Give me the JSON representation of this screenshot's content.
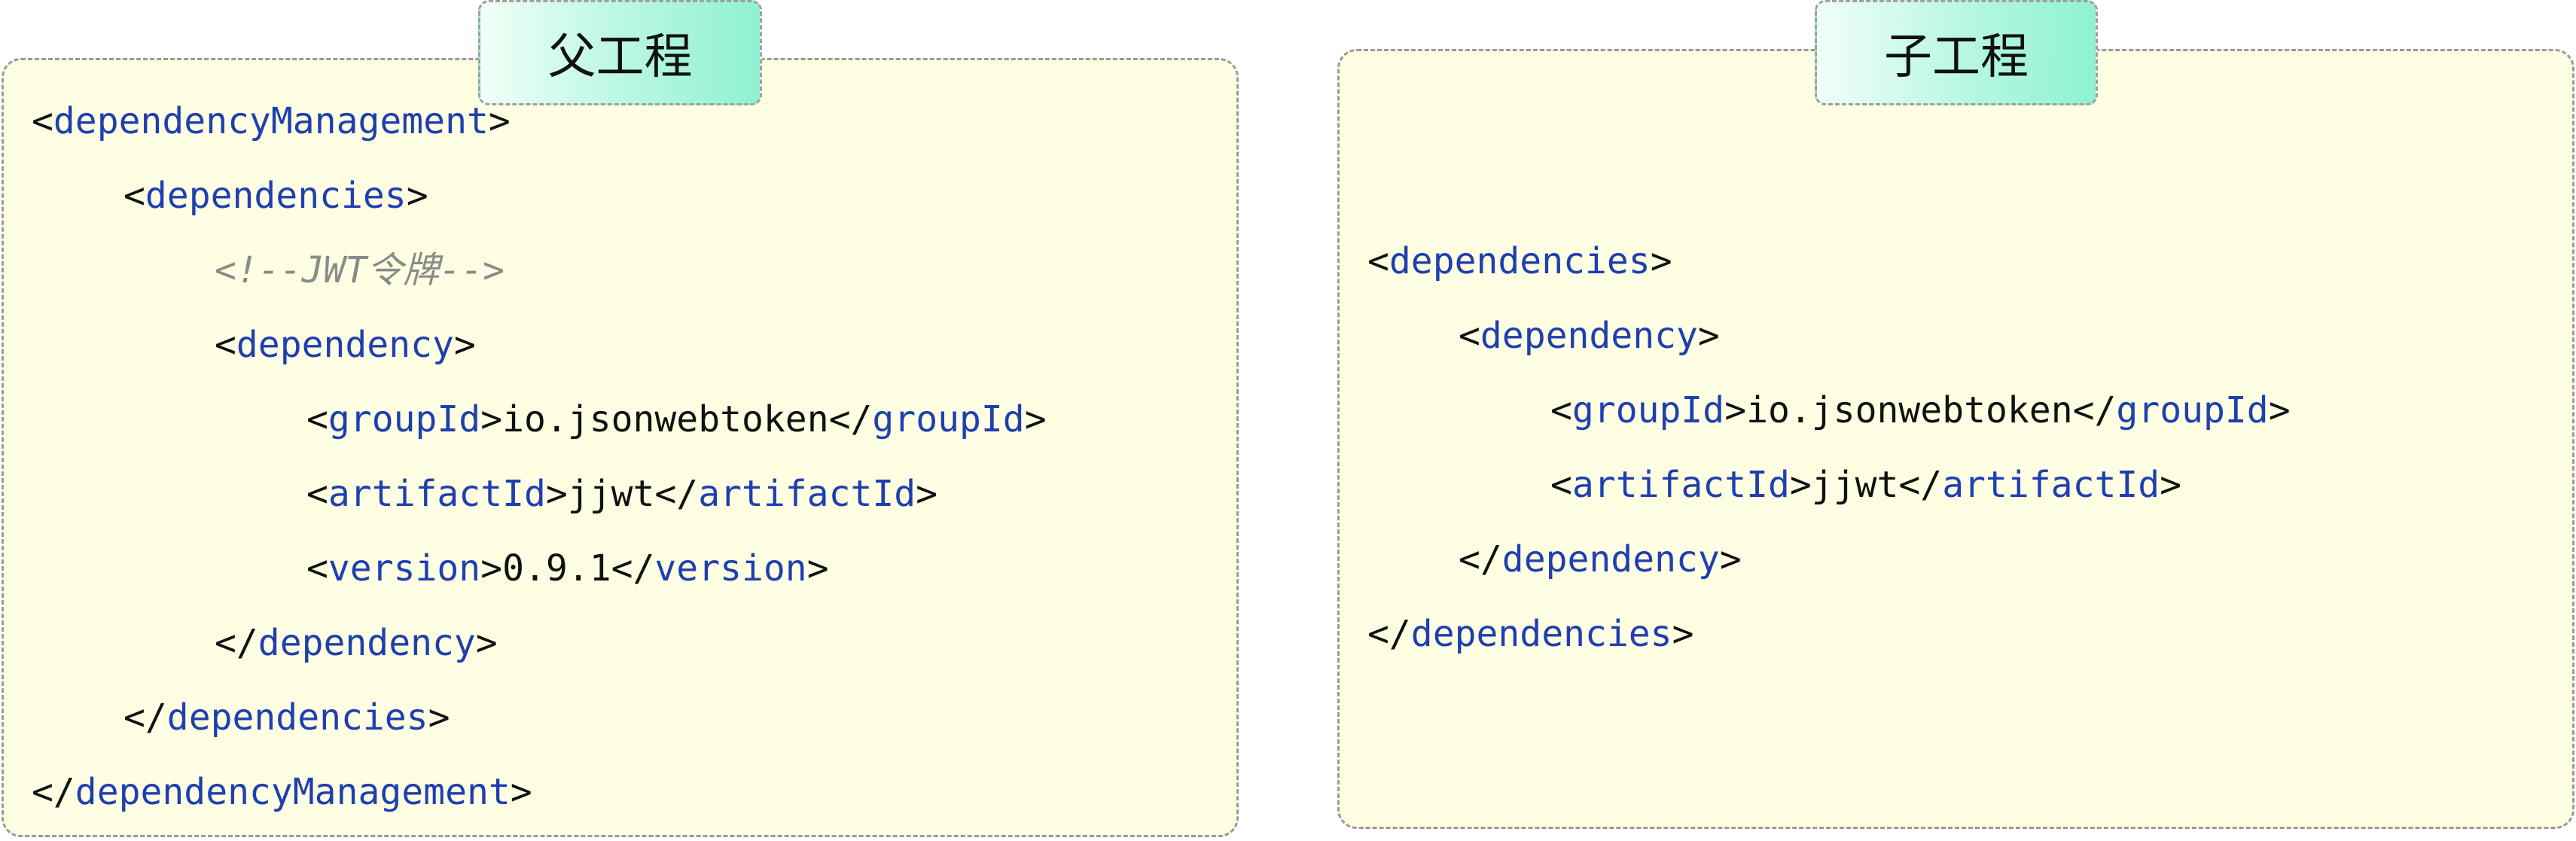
{
  "tabs": {
    "parent": "父工程",
    "child": "子工程"
  },
  "parent_code": {
    "dm_open": "dependencyManagement",
    "deps_open": "dependencies",
    "comment": "<!--JWT令牌-->",
    "dep_open": "dependency",
    "group_tag": "groupId",
    "group_value": "io.jsonwebtoken",
    "artifact_tag": "artifactId",
    "artifact_value": "jjwt",
    "version_tag": "version",
    "version_value": "0.9.1",
    "dep_close": "dependency",
    "deps_close": "dependencies",
    "dm_close": "dependencyManagement"
  },
  "child_code": {
    "deps_open": "dependencies",
    "dep_open": "dependency",
    "group_tag": "groupId",
    "group_value": "io.jsonwebtoken",
    "artifact_tag": "artifactId",
    "artifact_value": "jjwt",
    "dep_close": "dependency",
    "deps_close": "dependencies"
  }
}
